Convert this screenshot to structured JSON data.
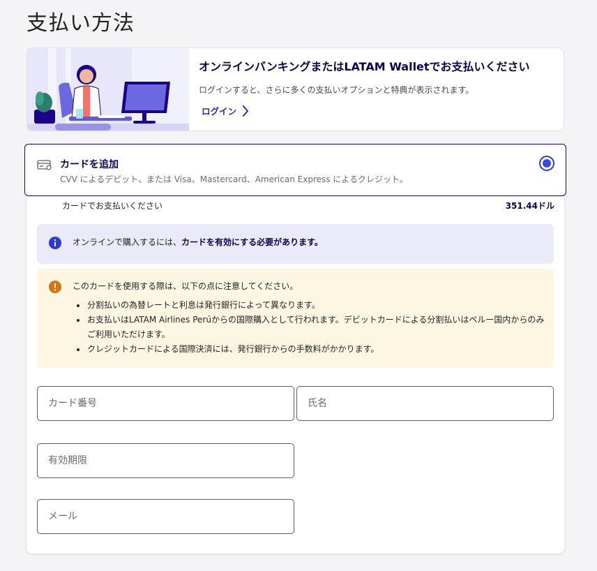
{
  "page": {
    "title": "支払い方法"
  },
  "banner": {
    "title": "オンラインバンキングまたはLATAM Walletでお支払いください",
    "subtitle": "ログインすると、さらに多くの支払いオプションと特典が表示されます。",
    "login_label": "ログイン",
    "colors": {
      "accent": "#2b2ab2",
      "illustration_bg": "#e8e6fb"
    }
  },
  "card_option": {
    "title": "カードを追加",
    "subtitle": "CVV によるデビット、または Visa、Mastercard、American Express によるクレジット。",
    "selected": true,
    "icon": "credit-card-icon"
  },
  "payment": {
    "label": "カードでお支払いください",
    "amount": "351.44ドル"
  },
  "info": {
    "icon": "info-icon",
    "text_plain": "オンラインで購入するには、",
    "text_bold": "カードを有効にする必要があります。"
  },
  "warning": {
    "icon": "warning-icon",
    "title": "このカードを使用する際は、以下の点に注意してください。",
    "items": [
      "分割払いの為替レートと利息は発行銀行によって異なります。",
      "お支払いはLATAM Airlines Perúからの国際購入として行われます。デビットカードによる分割払いはペルー国内からのみご利用いただけます。",
      "クレジットカードによる国際決済には、発行銀行からの手数料がかかります。"
    ]
  },
  "form": {
    "card_number_placeholder": "カード番号",
    "name_placeholder": "氏名",
    "expiry_placeholder": "有効期限",
    "email_placeholder": "メール"
  }
}
